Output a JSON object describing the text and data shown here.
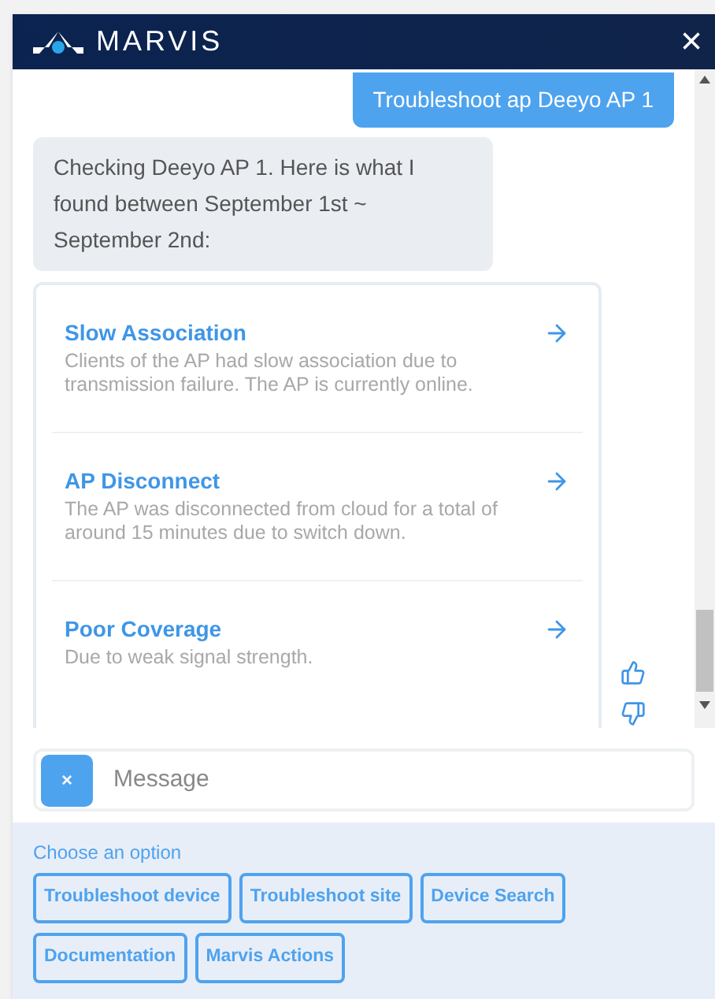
{
  "window": {
    "title": "MARVIS",
    "close": "×"
  },
  "messages": [
    {
      "kind": "user",
      "text": "Troubleshoot ap Deeyo AP 1"
    },
    {
      "kind": "bot",
      "text": "Checking Deeyo AP 1. Here is what I found between September 1st ~ September 2nd:"
    }
  ],
  "findings": [
    {
      "title": "Slow Association",
      "description": "Clients of the AP had slow association due to transmission failure. The AP is currently online."
    },
    {
      "title": "AP Disconnect",
      "description": "The AP was disconnected from cloud for a total of around 15 minutes due to switch down."
    },
    {
      "title": "Poor Coverage",
      "description": "Due to weak signal strength."
    }
  ],
  "composer": {
    "clear": "×",
    "placeholder": "Message"
  },
  "options": {
    "label": "Choose an option",
    "buttons": [
      "Troubleshoot device",
      "Troubleshoot site",
      "Device Search",
      "Documentation",
      "Marvis Actions"
    ]
  }
}
